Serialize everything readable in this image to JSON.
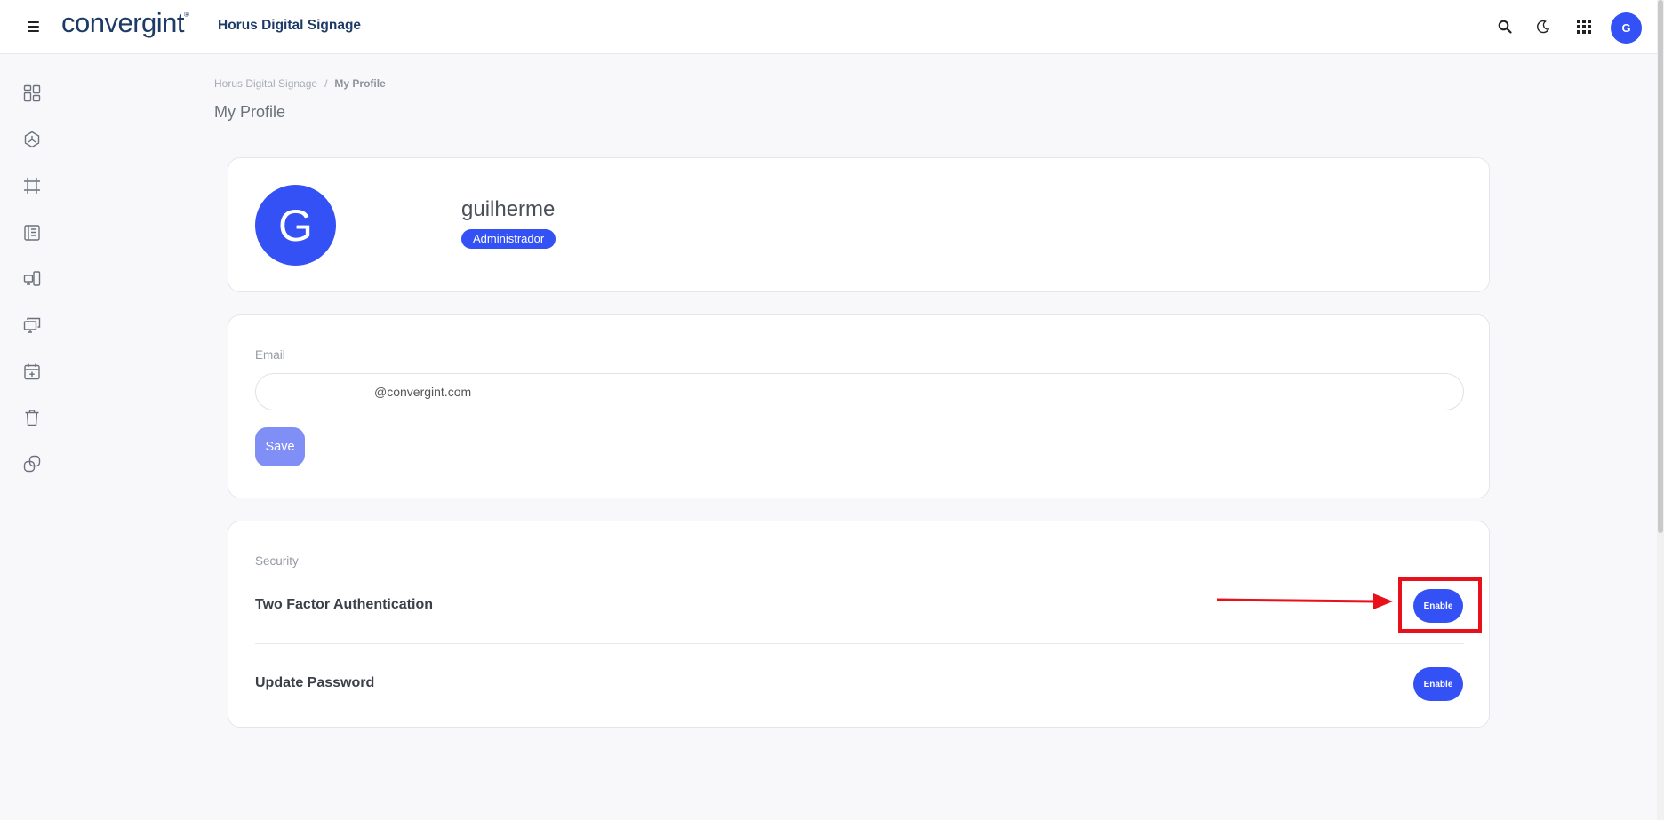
{
  "header": {
    "logo": "convergint",
    "app_title": "Horus Digital Signage",
    "avatar_initial": "G",
    "icons": [
      "menu-icon",
      "search-icon",
      "moon-icon",
      "apps-grid-icon"
    ]
  },
  "sidebar": {
    "items": [
      "dashboard-icon",
      "hexagon-icon",
      "frame-icon",
      "content-icon",
      "devices-icon",
      "screens-icon",
      "calendar-add-icon",
      "trash-icon",
      "link-icon"
    ]
  },
  "breadcrumb": {
    "root": "Horus Digital Signage",
    "separator": "/",
    "current": "My Profile"
  },
  "page_title": "My Profile",
  "profile": {
    "initial": "G",
    "username": "guilherme",
    "role": "Administrador"
  },
  "email_section": {
    "label": "Email",
    "value": "@convergint.com",
    "save_label": "Save"
  },
  "security": {
    "label": "Security",
    "rows": [
      {
        "label": "Two Factor Authentication",
        "button": "Enable"
      },
      {
        "label": "Update Password",
        "button": "Enable"
      }
    ]
  },
  "colors": {
    "accent": "#3351f4",
    "save_disabled": "#7f8ff5",
    "annotation": "#e8101a",
    "brand": "#1d3b66"
  }
}
